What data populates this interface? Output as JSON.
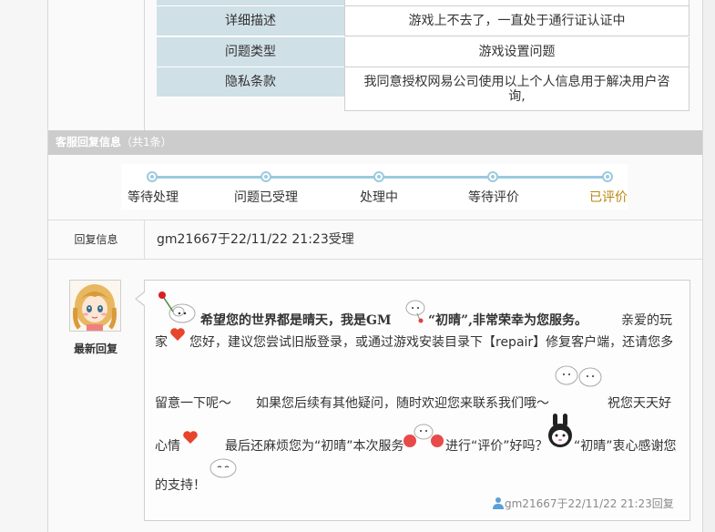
{
  "details": [
    {
      "label": "详细描述",
      "value": "游戏上不去了，一直处于通行证认证中"
    },
    {
      "label": "问题类型",
      "value": "游戏设置问题"
    },
    {
      "label": "隐私条款",
      "value_line1": "我同意授权网易公司使用以上个人信息用于解决用户咨",
      "value_line2": "询,"
    }
  ],
  "reply_section": {
    "title": "客服回复信息",
    "count": "（共1条）"
  },
  "progress": {
    "steps": [
      "等待处理",
      "问题已受理",
      "处理中",
      "等待评价",
      "已评价"
    ],
    "current_step": "已评价",
    "colors": {
      "line": "#9cc9e0",
      "current": "#b8860b"
    }
  },
  "reply_info": {
    "label": "回复信息",
    "text": "gm21667于22/11/22 21:23受理"
  },
  "latest_reply": {
    "caption": "最新回复",
    "line1_bold": "希望您的世界都是晴天，我是GM",
    "line1_bold2": "“初晴”,非常荣幸为您服务。",
    "line1_tail": "亲爱的玩",
    "line2_a": "家",
    "line2_b": "您好，建议您尝试旧版登录，或通过游戏安装目录下【repair】修复客户端，还请您多",
    "line3_a": "留意一下呢～",
    "line3_b": "如果您后续有其他疑问，随时欢迎您来联系我们哦～",
    "line3_c": "祝您天天好",
    "line4_a": "心情",
    "line4_b": "最后还麻烦您为“初晴”本次服务",
    "line4_c": "进行“评价”好吗？",
    "line4_d": "“初晴”衷心感谢您",
    "line5": "的支持！",
    "footer": "gm21667于22/11/22 21:23回复"
  }
}
